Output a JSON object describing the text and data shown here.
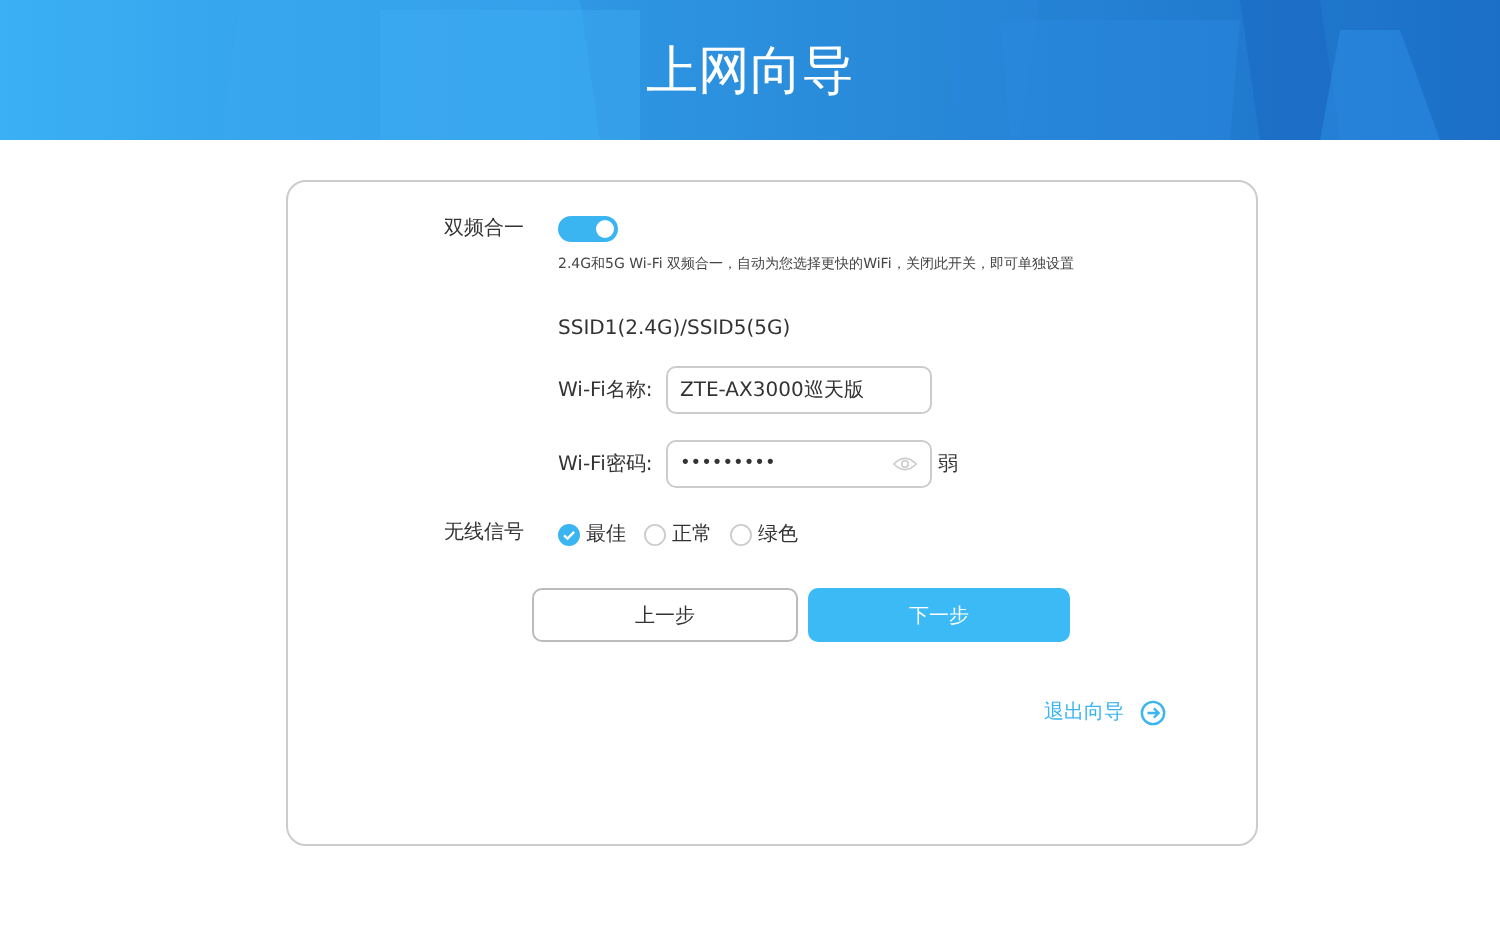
{
  "header": {
    "title": "上网向导"
  },
  "dual_band": {
    "label": "双频合一",
    "on": true,
    "note": "2.4G和5G Wi-Fi 双频合一，自动为您选择更快的WiFi，关闭此开关，即可单独设置"
  },
  "ssid_heading": "SSID1(2.4G)/SSID5(5G)",
  "wifi_name": {
    "label": "Wi-Fi名称:",
    "value": "ZTE-AX3000巡天版"
  },
  "wifi_password": {
    "label": "Wi-Fi密码:",
    "value": "•••••••••",
    "strength": "弱"
  },
  "signal": {
    "label": "无线信号",
    "options": [
      {
        "label": "最佳",
        "selected": true
      },
      {
        "label": "正常",
        "selected": false
      },
      {
        "label": "绿色",
        "selected": false
      }
    ]
  },
  "buttons": {
    "back": "上一步",
    "next": "下一步"
  },
  "exit_link": "退出向导"
}
